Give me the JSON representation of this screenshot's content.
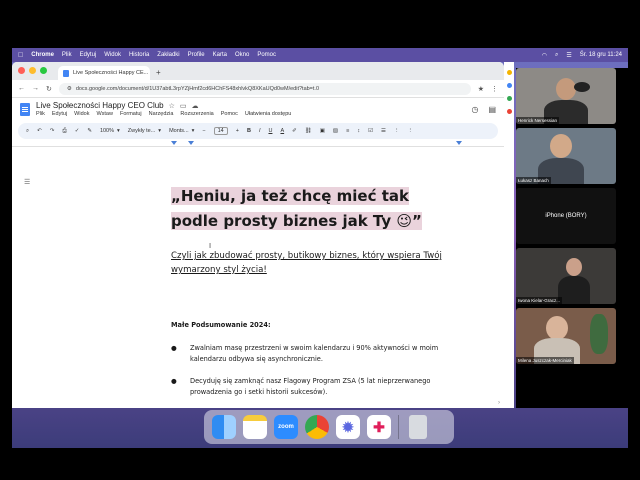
{
  "menubar": {
    "app": "Chrome",
    "items": [
      "Plik",
      "Edytuj",
      "Widok",
      "Historia",
      "Zakładki",
      "Profile",
      "Karta",
      "Okno",
      "Pomoc"
    ],
    "datetime": "Śr. 18 gru  11:24"
  },
  "browser": {
    "tab_title": "Live Społeczności Happy CE...",
    "url": "docs.google.com/document/d/1U37abtL3rpYZjHmf2cd6HChFS48xhlvkQ8XKaUQd0wM/edit?tab=t.0"
  },
  "docs": {
    "title": "Live Społeczności Happy CEO Club",
    "menu": [
      "Plik",
      "Edytuj",
      "Widok",
      "Wstaw",
      "Formatuj",
      "Narzędzia",
      "Rozszerzenia",
      "Pomoc",
      "Ułatwienia dostępu"
    ],
    "toolbar": {
      "zoom": "100%",
      "style": "Zwykły te...",
      "font": "Monts...",
      "size": "14"
    }
  },
  "document": {
    "headline_line1": "„Heniu, ja też chcę mieć tak",
    "headline_line2": "podle prosty biznes jak Ty 😉”",
    "subtitle": "Czyli jak zbudować prosty, butikowy biznes, który wspiera Twój wymarzony styl życia!",
    "section_title": "Małe Podsumowanie 2024:",
    "bullets": [
      "Zwalniam masę przestrzeni w swoim kalendarzu i 90% aktywności w moim kalendarzu odbywa się asynchronicznie.",
      "Decyduję się zamknąć nasz Flagowy Program ZSA (5 lat nieprzerwanego prowadzenia go i setki historii sukcesów)."
    ]
  },
  "participants": [
    {
      "name": "Henrick Nersessian"
    },
    {
      "name": "Łukasz Banach"
    },
    {
      "name": "iPhone (BORY)"
    },
    {
      "name": "Iwona Kielar-Gracz..."
    },
    {
      "name": "Milena Juszczak-Merciniak"
    }
  ],
  "dock": {
    "apps": [
      "finder-icon",
      "notes-icon",
      "zoom-icon",
      "chrome-icon",
      "settings-icon",
      "slack-icon",
      "trash-icon"
    ],
    "zoom_label": "zoom"
  }
}
